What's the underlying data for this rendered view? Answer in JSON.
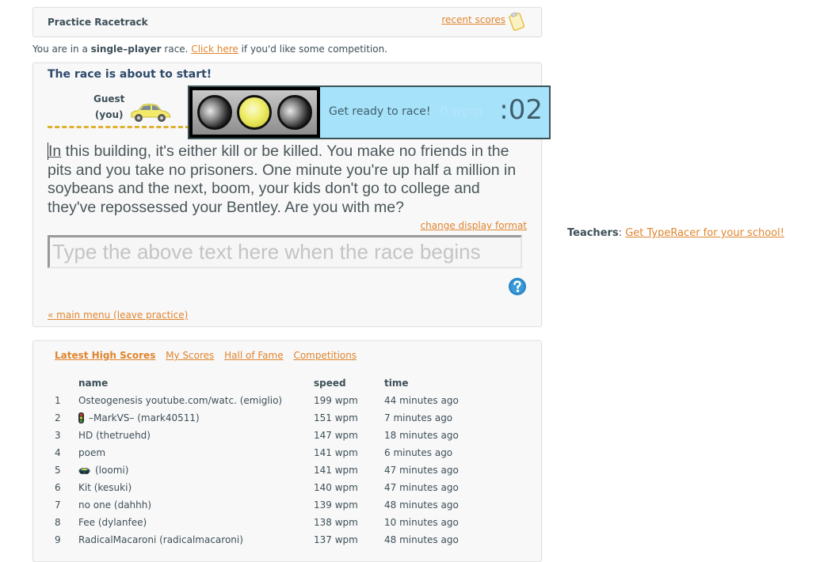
{
  "header": {
    "title": "Practice Racetrack",
    "recent_scores_link": "recent scores",
    "recent_scores_icon": "clipboard-icon"
  },
  "mode_notice": {
    "prefix": "You are in a ",
    "mode": "single–player",
    "middle": " race. ",
    "link": "Click here",
    "suffix": " if you'd like some competition."
  },
  "race": {
    "heading": "The race is about to start!",
    "racer_name": "Guest",
    "racer_tag": "(you)",
    "car_color": "#f3ea6a",
    "text_first_word": "In",
    "text_rest": " this building, it's either kill or be killed. You make no friends in the pits and you take no prisoners. One minute you're up half a million in soybeans and the next, boom, your kids don't go to college and they've repossessed your Bentley. Are you with me?",
    "change_display_format": "change display format",
    "input_value": "",
    "input_placeholder": "Type the above text here when the race begins",
    "help_icon": "question-icon",
    "main_menu_link": "« main menu (leave practice)"
  },
  "countdown_popup": {
    "traffic_light_state": "yellow",
    "message": "Get ready to race!",
    "wpm_ghost": "0 wpm",
    "countdown": ":02",
    "background_color": "#a6e2fa"
  },
  "teachers": {
    "label": "Teachers",
    "separator": ": ",
    "link": "Get TypeRacer for your school!"
  },
  "scores": {
    "tabs": [
      {
        "label": "Latest High Scores",
        "active": true
      },
      {
        "label": "My Scores",
        "active": false
      },
      {
        "label": "Hall of Fame",
        "active": false
      },
      {
        "label": "Competitions",
        "active": false
      }
    ],
    "columns": {
      "rank": "",
      "name": "name",
      "speed": "speed",
      "time": "time"
    },
    "rows": [
      {
        "rank": "1",
        "icon": "",
        "name": "Osteogenesis youtube.com/watc. (emiglio)",
        "speed": "199 wpm",
        "time": "44 minutes ago"
      },
      {
        "rank": "2",
        "icon": "traffic-light-icon",
        "name": "–MarkVS– (mark40511)",
        "speed": "151 wpm",
        "time": "7 minutes ago"
      },
      {
        "rank": "3",
        "icon": "",
        "name": "HD (thetruehd)",
        "speed": "147 wpm",
        "time": "18 minutes ago"
      },
      {
        "rank": "4",
        "icon": "",
        "name": "poem",
        "speed": "141 wpm",
        "time": "6 minutes ago"
      },
      {
        "rank": "5",
        "icon": "car-badge-icon",
        "name": "(loomi)",
        "speed": "141 wpm",
        "time": "47 minutes ago"
      },
      {
        "rank": "6",
        "icon": "",
        "name": "Kit (kesuki)",
        "speed": "140 wpm",
        "time": "47 minutes ago"
      },
      {
        "rank": "7",
        "icon": "",
        "name": "no one (dahhh)",
        "speed": "139 wpm",
        "time": "48 minutes ago"
      },
      {
        "rank": "8",
        "icon": "",
        "name": "Fee (dylanfee)",
        "speed": "138 wpm",
        "time": "10 minutes ago"
      },
      {
        "rank": "9",
        "icon": "",
        "name": "RadicalMacaroni (radicalmacaroni)",
        "speed": "137 wpm",
        "time": "48 minutes ago"
      }
    ]
  },
  "colors": {
    "link": "#e0842d",
    "heading": "#2e4a6b",
    "text": "#3d4f58",
    "track_dash": "#e0b030"
  }
}
